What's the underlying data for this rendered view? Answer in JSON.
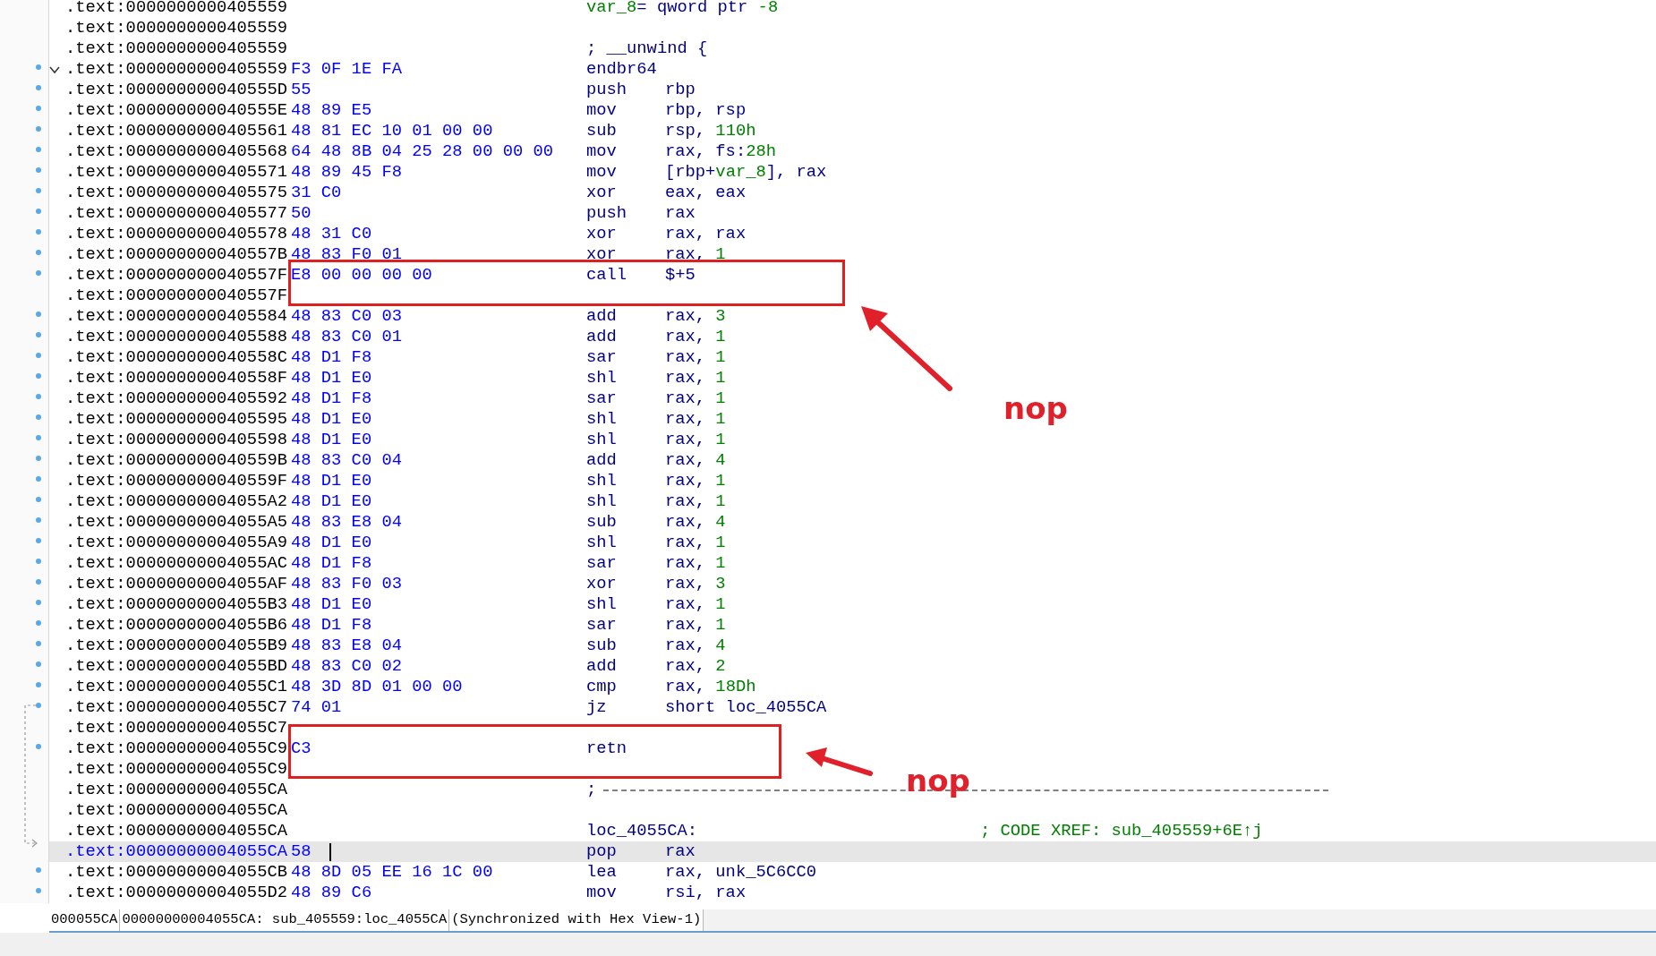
{
  "listing": [
    {
      "kind": "comment",
      "address": ".text:0000000000405559",
      "dot": false,
      "selected": false,
      "parts": [
        {
          "text": "var_8",
          "kind": "num"
        },
        {
          "text": "= qword ptr ",
          "kind": "plain"
        },
        {
          "text": "-8",
          "kind": "num"
        }
      ]
    },
    {
      "kind": "blank",
      "address": ".text:0000000000405559",
      "dot": false,
      "selected": false
    },
    {
      "kind": "comment",
      "address": ".text:0000000000405559",
      "dot": false,
      "selected": false,
      "parts": [
        {
          "text": "; __unwind {",
          "kind": "plain"
        }
      ]
    },
    {
      "kind": "instr",
      "address": ".text:0000000000405559",
      "dot": true,
      "selected": false,
      "fold_expanded": true,
      "bytes": "F3 0F 1E FA",
      "mnemonic": "endbr64"
    },
    {
      "kind": "instr",
      "address": ".text:000000000040555D",
      "dot": true,
      "selected": false,
      "bytes": "55",
      "mnemonic": "push",
      "operands": [
        {
          "text": "rbp",
          "kind": "plain"
        }
      ]
    },
    {
      "kind": "instr",
      "address": ".text:000000000040555E",
      "dot": true,
      "selected": false,
      "bytes": "48 89 E5",
      "mnemonic": "mov",
      "operands": [
        {
          "text": "rbp, rsp",
          "kind": "plain"
        }
      ]
    },
    {
      "kind": "instr",
      "address": ".text:0000000000405561",
      "dot": true,
      "selected": false,
      "bytes": "48 81 EC 10 01 00 00",
      "mnemonic": "sub",
      "operands": [
        {
          "text": "rsp, ",
          "kind": "plain"
        },
        {
          "text": "110h",
          "kind": "num"
        }
      ]
    },
    {
      "kind": "instr",
      "address": ".text:0000000000405568",
      "dot": true,
      "selected": false,
      "bytes": "64 48 8B 04 25 28 00 00 00",
      "mnemonic": "mov",
      "operands": [
        {
          "text": "rax, fs:",
          "kind": "plain"
        },
        {
          "text": "28h",
          "kind": "num"
        }
      ]
    },
    {
      "kind": "instr",
      "address": ".text:0000000000405571",
      "dot": true,
      "selected": false,
      "bytes": "48 89 45 F8",
      "mnemonic": "mov",
      "operands": [
        {
          "text": "[rbp+",
          "kind": "plain"
        },
        {
          "text": "var_8",
          "kind": "num"
        },
        {
          "text": "], rax",
          "kind": "plain"
        }
      ]
    },
    {
      "kind": "instr",
      "address": ".text:0000000000405575",
      "dot": true,
      "selected": false,
      "bytes": "31 C0",
      "mnemonic": "xor",
      "operands": [
        {
          "text": "eax, eax",
          "kind": "plain"
        }
      ]
    },
    {
      "kind": "instr",
      "address": ".text:0000000000405577",
      "dot": true,
      "selected": false,
      "bytes": "50",
      "mnemonic": "push",
      "operands": [
        {
          "text": "rax",
          "kind": "plain"
        }
      ]
    },
    {
      "kind": "instr",
      "address": ".text:0000000000405578",
      "dot": true,
      "selected": false,
      "bytes": "48 31 C0",
      "mnemonic": "xor",
      "operands": [
        {
          "text": "rax, rax",
          "kind": "plain"
        }
      ]
    },
    {
      "kind": "instr",
      "address": ".text:000000000040557B",
      "dot": true,
      "selected": false,
      "bytes": "48 83 F0 01",
      "mnemonic": "xor",
      "operands": [
        {
          "text": "rax, ",
          "kind": "plain"
        },
        {
          "text": "1",
          "kind": "num"
        }
      ]
    },
    {
      "kind": "instr",
      "address": ".text:000000000040557F",
      "dot": true,
      "selected": false,
      "bytes": "E8 00 00 00 00",
      "mnemonic": "call",
      "operands": [
        {
          "text": "$+5",
          "kind": "plain"
        }
      ]
    },
    {
      "kind": "blank",
      "address": ".text:000000000040557F",
      "dot": false,
      "selected": false
    },
    {
      "kind": "instr",
      "address": ".text:0000000000405584",
      "dot": true,
      "selected": false,
      "bytes": "48 83 C0 03",
      "mnemonic": "add",
      "operands": [
        {
          "text": "rax, ",
          "kind": "plain"
        },
        {
          "text": "3",
          "kind": "num"
        }
      ]
    },
    {
      "kind": "instr",
      "address": ".text:0000000000405588",
      "dot": true,
      "selected": false,
      "bytes": "48 83 C0 01",
      "mnemonic": "add",
      "operands": [
        {
          "text": "rax, ",
          "kind": "plain"
        },
        {
          "text": "1",
          "kind": "num"
        }
      ]
    },
    {
      "kind": "instr",
      "address": ".text:000000000040558C",
      "dot": true,
      "selected": false,
      "bytes": "48 D1 F8",
      "mnemonic": "sar",
      "operands": [
        {
          "text": "rax, ",
          "kind": "plain"
        },
        {
          "text": "1",
          "kind": "num"
        }
      ]
    },
    {
      "kind": "instr",
      "address": ".text:000000000040558F",
      "dot": true,
      "selected": false,
      "bytes": "48 D1 E0",
      "mnemonic": "shl",
      "operands": [
        {
          "text": "rax, ",
          "kind": "plain"
        },
        {
          "text": "1",
          "kind": "num"
        }
      ]
    },
    {
      "kind": "instr",
      "address": ".text:0000000000405592",
      "dot": true,
      "selected": false,
      "bytes": "48 D1 F8",
      "mnemonic": "sar",
      "operands": [
        {
          "text": "rax, ",
          "kind": "plain"
        },
        {
          "text": "1",
          "kind": "num"
        }
      ]
    },
    {
      "kind": "instr",
      "address": ".text:0000000000405595",
      "dot": true,
      "selected": false,
      "bytes": "48 D1 E0",
      "mnemonic": "shl",
      "operands": [
        {
          "text": "rax, ",
          "kind": "plain"
        },
        {
          "text": "1",
          "kind": "num"
        }
      ]
    },
    {
      "kind": "instr",
      "address": ".text:0000000000405598",
      "dot": true,
      "selected": false,
      "bytes": "48 D1 E0",
      "mnemonic": "shl",
      "operands": [
        {
          "text": "rax, ",
          "kind": "plain"
        },
        {
          "text": "1",
          "kind": "num"
        }
      ]
    },
    {
      "kind": "instr",
      "address": ".text:000000000040559B",
      "dot": true,
      "selected": false,
      "bytes": "48 83 C0 04",
      "mnemonic": "add",
      "operands": [
        {
          "text": "rax, ",
          "kind": "plain"
        },
        {
          "text": "4",
          "kind": "num"
        }
      ]
    },
    {
      "kind": "instr",
      "address": ".text:000000000040559F",
      "dot": true,
      "selected": false,
      "bytes": "48 D1 E0",
      "mnemonic": "shl",
      "operands": [
        {
          "text": "rax, ",
          "kind": "plain"
        },
        {
          "text": "1",
          "kind": "num"
        }
      ]
    },
    {
      "kind": "instr",
      "address": ".text:00000000004055A2",
      "dot": true,
      "selected": false,
      "bytes": "48 D1 E0",
      "mnemonic": "shl",
      "operands": [
        {
          "text": "rax, ",
          "kind": "plain"
        },
        {
          "text": "1",
          "kind": "num"
        }
      ]
    },
    {
      "kind": "instr",
      "address": ".text:00000000004055A5",
      "dot": true,
      "selected": false,
      "bytes": "48 83 E8 04",
      "mnemonic": "sub",
      "operands": [
        {
          "text": "rax, ",
          "kind": "plain"
        },
        {
          "text": "4",
          "kind": "num"
        }
      ]
    },
    {
      "kind": "instr",
      "address": ".text:00000000004055A9",
      "dot": true,
      "selected": false,
      "bytes": "48 D1 E0",
      "mnemonic": "shl",
      "operands": [
        {
          "text": "rax, ",
          "kind": "plain"
        },
        {
          "text": "1",
          "kind": "num"
        }
      ]
    },
    {
      "kind": "instr",
      "address": ".text:00000000004055AC",
      "dot": true,
      "selected": false,
      "bytes": "48 D1 F8",
      "mnemonic": "sar",
      "operands": [
        {
          "text": "rax, ",
          "kind": "plain"
        },
        {
          "text": "1",
          "kind": "num"
        }
      ]
    },
    {
      "kind": "instr",
      "address": ".text:00000000004055AF",
      "dot": true,
      "selected": false,
      "bytes": "48 83 F0 03",
      "mnemonic": "xor",
      "operands": [
        {
          "text": "rax, ",
          "kind": "plain"
        },
        {
          "text": "3",
          "kind": "num"
        }
      ]
    },
    {
      "kind": "instr",
      "address": ".text:00000000004055B3",
      "dot": true,
      "selected": false,
      "bytes": "48 D1 E0",
      "mnemonic": "shl",
      "operands": [
        {
          "text": "rax, ",
          "kind": "plain"
        },
        {
          "text": "1",
          "kind": "num"
        }
      ]
    },
    {
      "kind": "instr",
      "address": ".text:00000000004055B6",
      "dot": true,
      "selected": false,
      "bytes": "48 D1 F8",
      "mnemonic": "sar",
      "operands": [
        {
          "text": "rax, ",
          "kind": "plain"
        },
        {
          "text": "1",
          "kind": "num"
        }
      ]
    },
    {
      "kind": "instr",
      "address": ".text:00000000004055B9",
      "dot": true,
      "selected": false,
      "bytes": "48 83 E8 04",
      "mnemonic": "sub",
      "operands": [
        {
          "text": "rax, ",
          "kind": "plain"
        },
        {
          "text": "4",
          "kind": "num"
        }
      ]
    },
    {
      "kind": "instr",
      "address": ".text:00000000004055BD",
      "dot": true,
      "selected": false,
      "bytes": "48 83 C0 02",
      "mnemonic": "add",
      "operands": [
        {
          "text": "rax, ",
          "kind": "plain"
        },
        {
          "text": "2",
          "kind": "num"
        }
      ]
    },
    {
      "kind": "instr",
      "address": ".text:00000000004055C1",
      "dot": true,
      "selected": false,
      "bytes": "48 3D 8D 01 00 00",
      "mnemonic": "cmp",
      "operands": [
        {
          "text": "rax, ",
          "kind": "plain"
        },
        {
          "text": "18Dh",
          "kind": "num"
        }
      ]
    },
    {
      "kind": "instr",
      "address": ".text:00000000004055C7",
      "dot": true,
      "selected": false,
      "bytes": "74 01",
      "mnemonic": "jz",
      "operands": [
        {
          "text": "short loc_4055CA",
          "kind": "plain"
        }
      ]
    },
    {
      "kind": "blank",
      "address": ".text:00000000004055C7",
      "dot": false,
      "selected": false
    },
    {
      "kind": "instr",
      "address": ".text:00000000004055C9",
      "dot": true,
      "selected": false,
      "bytes": "C3",
      "mnemonic": "retn"
    },
    {
      "kind": "blank",
      "address": ".text:00000000004055C9",
      "dot": false,
      "selected": false
    },
    {
      "kind": "separator",
      "address": ".text:00000000004055CA",
      "dot": false,
      "selected": false,
      "parts": [
        {
          "text": ";",
          "kind": "plain"
        }
      ]
    },
    {
      "kind": "blank",
      "address": ".text:00000000004055CA",
      "dot": false,
      "selected": false
    },
    {
      "kind": "label",
      "address": ".text:00000000004055CA",
      "dot": false,
      "selected": false,
      "label": "loc_4055CA:",
      "xref": "; CODE XREF: sub_405559+6E↑j"
    },
    {
      "kind": "instr",
      "address": ".text:00000000004055CA",
      "dot": false,
      "selected": true,
      "bytes": "58",
      "mnemonic": "pop",
      "operands": [
        {
          "text": "rax",
          "kind": "plain"
        }
      ]
    },
    {
      "kind": "instr",
      "address": ".text:00000000004055CB",
      "dot": true,
      "selected": false,
      "bytes": "48 8D 05 EE 16 1C 00",
      "mnemonic": "lea",
      "operands": [
        {
          "text": "rax, unk_5C6CC0",
          "kind": "plain"
        }
      ]
    },
    {
      "kind": "instr",
      "address": ".text:00000000004055D2",
      "dot": true,
      "selected": false,
      "bytes": "48 89 C6",
      "mnemonic": "mov",
      "operands": [
        {
          "text": "rsi, rax",
          "kind": "plain"
        }
      ]
    }
  ],
  "annotations": [
    {
      "label": "nop"
    },
    {
      "label": "nop"
    }
  ],
  "status_bar": [
    "000055CA",
    "00000000004055CA: sub_405559:loc_4055CA",
    "(Synchronized with Hex View-1)"
  ]
}
